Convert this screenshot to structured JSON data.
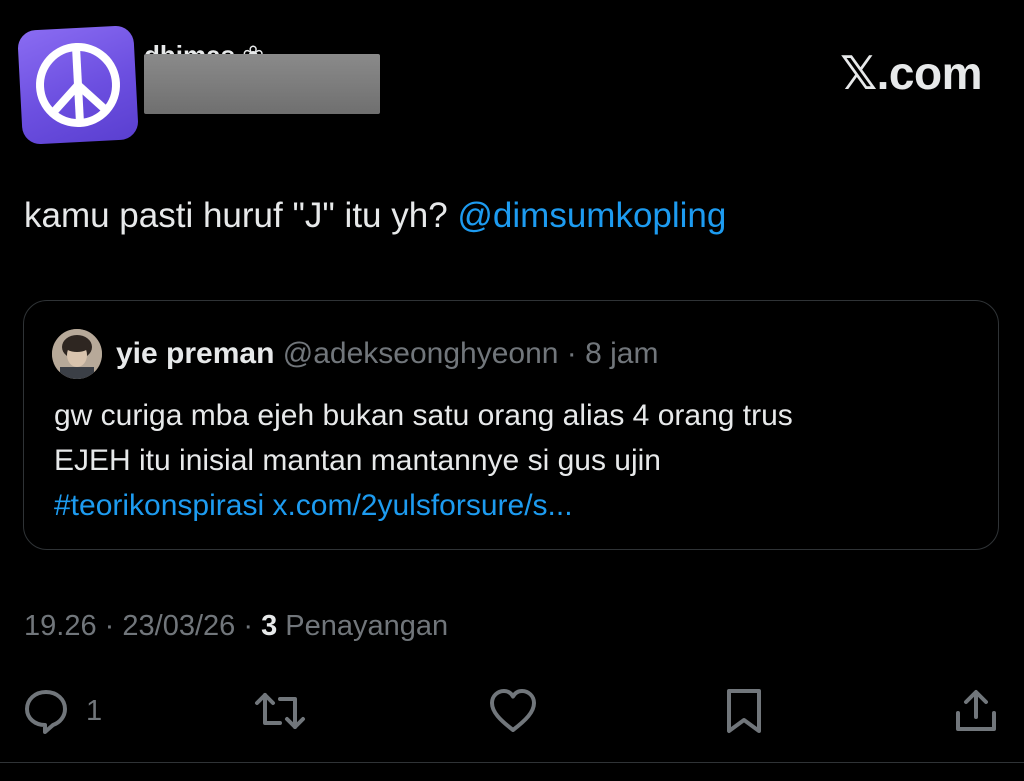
{
  "header": {
    "name_fragment": "dhimas ❀",
    "brand": "𝕏.com"
  },
  "tweet": {
    "text": "kamu pasti huruf \"J\" itu yh?",
    "mention": "@dimsumkopling"
  },
  "quote": {
    "name": "yie preman",
    "handle": "@adekseonghyeonn",
    "separator": "·",
    "time": "8 jam",
    "line1": "gw curiga mba ejeh bukan satu orang alias 4 orang trus",
    "line2": "EJEH itu inisial mantan mantannye si gus ujin",
    "hashtag": "#teorikonspirasi",
    "url": "x.com/2yulsforsure/s..."
  },
  "meta": {
    "time": "19.26",
    "sep1": "·",
    "date": "23/03/26",
    "sep2": "·",
    "views_count": "3",
    "views_label": "Penayangan"
  },
  "actions": {
    "reply_count": "1",
    "reply_icon": "reply-icon",
    "retweet_icon": "retweet-icon",
    "like_icon": "heart-icon",
    "bookmark_icon": "bookmark-icon",
    "share_icon": "share-icon"
  },
  "colors": {
    "background": "#000000",
    "text": "#e7e9ea",
    "muted": "#71767b",
    "link": "#1d9bf0",
    "avatar": "#7b5cf0",
    "border": "#2f3336"
  }
}
